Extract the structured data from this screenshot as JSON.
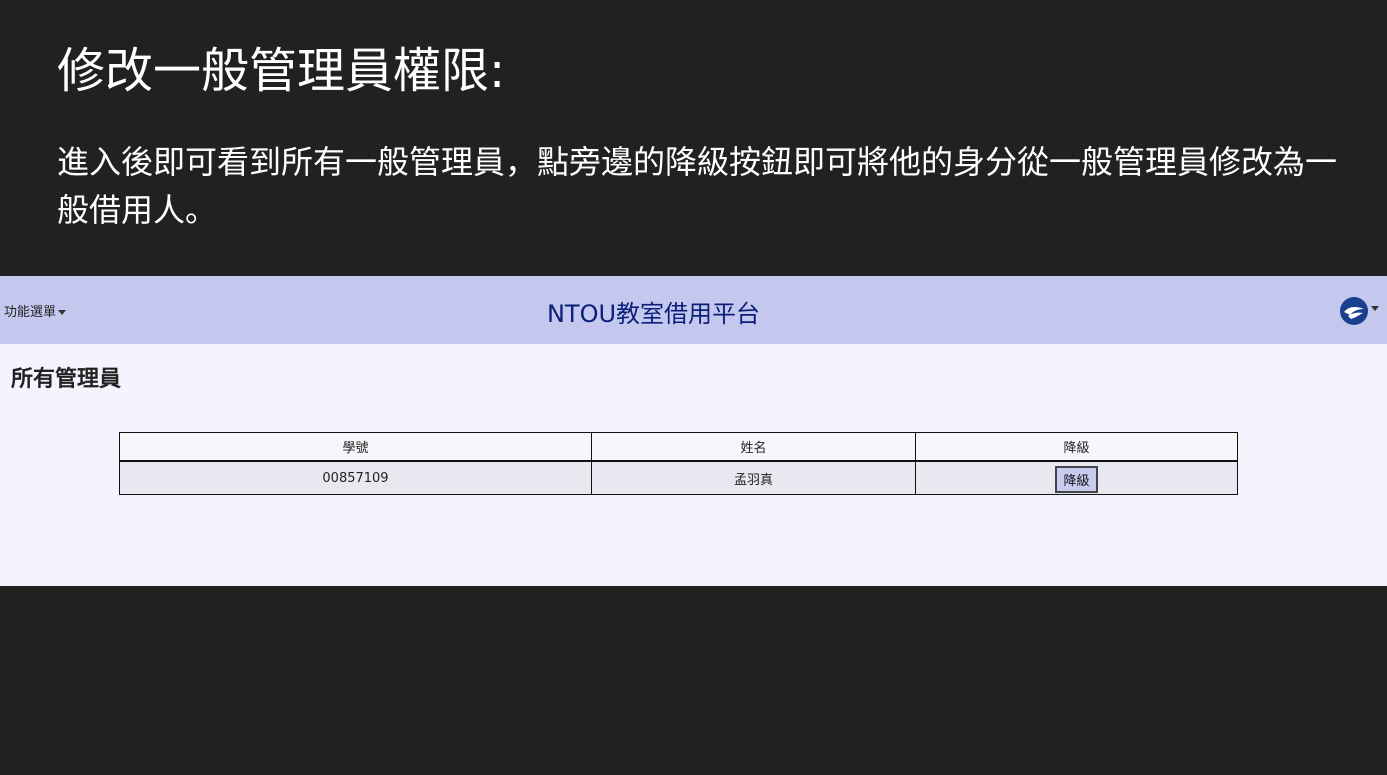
{
  "slide": {
    "title": "修改一般管理員權限:",
    "body": "進入後即可看到所有一般管理員，點旁邊的降級按鈕即可將他的身分從一般管理員修改為一般借用人。"
  },
  "navbar": {
    "menu_label": "功能選單",
    "brand": "NTOU教室借用平台",
    "user_icon": "ntou-logo-icon"
  },
  "page": {
    "heading": "所有管理員"
  },
  "table": {
    "headers": [
      "學號",
      "姓名",
      "降級"
    ],
    "rows": [
      {
        "student_id": "00857109",
        "name": "孟羽真",
        "action_label": "降級"
      }
    ]
  },
  "colors": {
    "slide_background": "#212121",
    "navbar_background": "#c5c8ee",
    "brand_text": "#0a1e7a",
    "page_background": "#f4f4fe",
    "row_background": "#e8e8f0",
    "button_background": "#c8caf0"
  }
}
